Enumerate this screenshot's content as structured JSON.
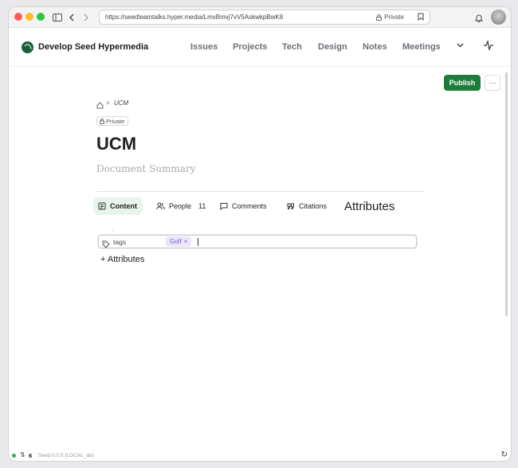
{
  "browser": {
    "url": "https://seedteamtalks.hyper.media/LmvBmvj7vV5AskwkpBwK8",
    "privacy_label": "Private"
  },
  "site": {
    "title": "Develop Seed Hypermedia",
    "nav": [
      "Issues",
      "Projects",
      "Tech",
      "Design",
      "Notes",
      "Meetings"
    ]
  },
  "toolbar": {
    "publish_label": "Publish",
    "more_label": "···"
  },
  "breadcrumb": {
    "separator": ">",
    "current": "UCM"
  },
  "document": {
    "privacy_badge": "Private",
    "title": "UCM",
    "summary_placeholder": "Document Summary"
  },
  "tabs": {
    "content": "Content",
    "people": "People",
    "people_count": "11",
    "comments": "Comments",
    "citations": "Citations",
    "attributes": "Attributes"
  },
  "attributes": {
    "tags_label": "tags",
    "tags": [
      "Golf"
    ],
    "tag_remove": "×",
    "add_label": "+ Attributes"
  },
  "status": {
    "sync_count": "6",
    "version": "Seed 0.0.0 (LOCAL_ab)"
  },
  "colors": {
    "accent": "#1e7d3a",
    "active_tab_bg": "#e7f4e9",
    "tag_bg": "#ece6fb",
    "tag_text": "#7b5ad1"
  }
}
